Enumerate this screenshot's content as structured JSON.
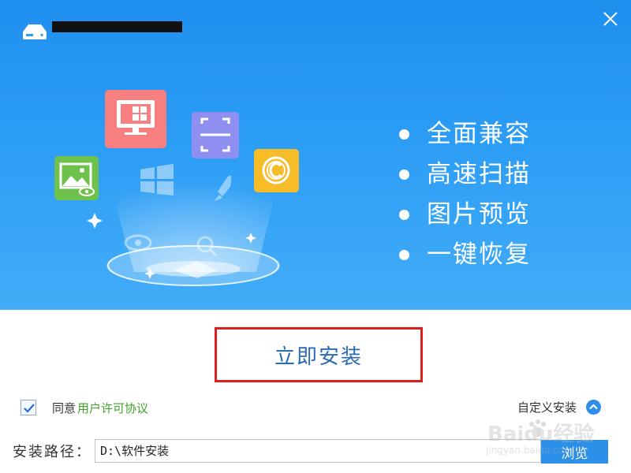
{
  "window": {
    "title": "",
    "close_icon": "close-icon"
  },
  "features": [
    {
      "label": "全面兼容"
    },
    {
      "label": "高速扫描"
    },
    {
      "label": "图片预览"
    },
    {
      "label": "一键恢复"
    }
  ],
  "install": {
    "label": "立即安装"
  },
  "agreement": {
    "checked": true,
    "prefix": "同意",
    "link": "用户许可协议"
  },
  "custom_install": {
    "label": "自定义安装"
  },
  "install_path": {
    "label": "安装路径：",
    "value": "D:\\软件安装",
    "browse_label": "浏览"
  },
  "watermark": {
    "brand": "Baidu经验",
    "url": "jingyan.baidu.com"
  },
  "colors": {
    "banner": "#2c9df5",
    "install_border": "#e01e1e",
    "install_text": "#2b6ab5",
    "link_green": "#3fa32b",
    "accent_blue": "#2c8fe8"
  }
}
